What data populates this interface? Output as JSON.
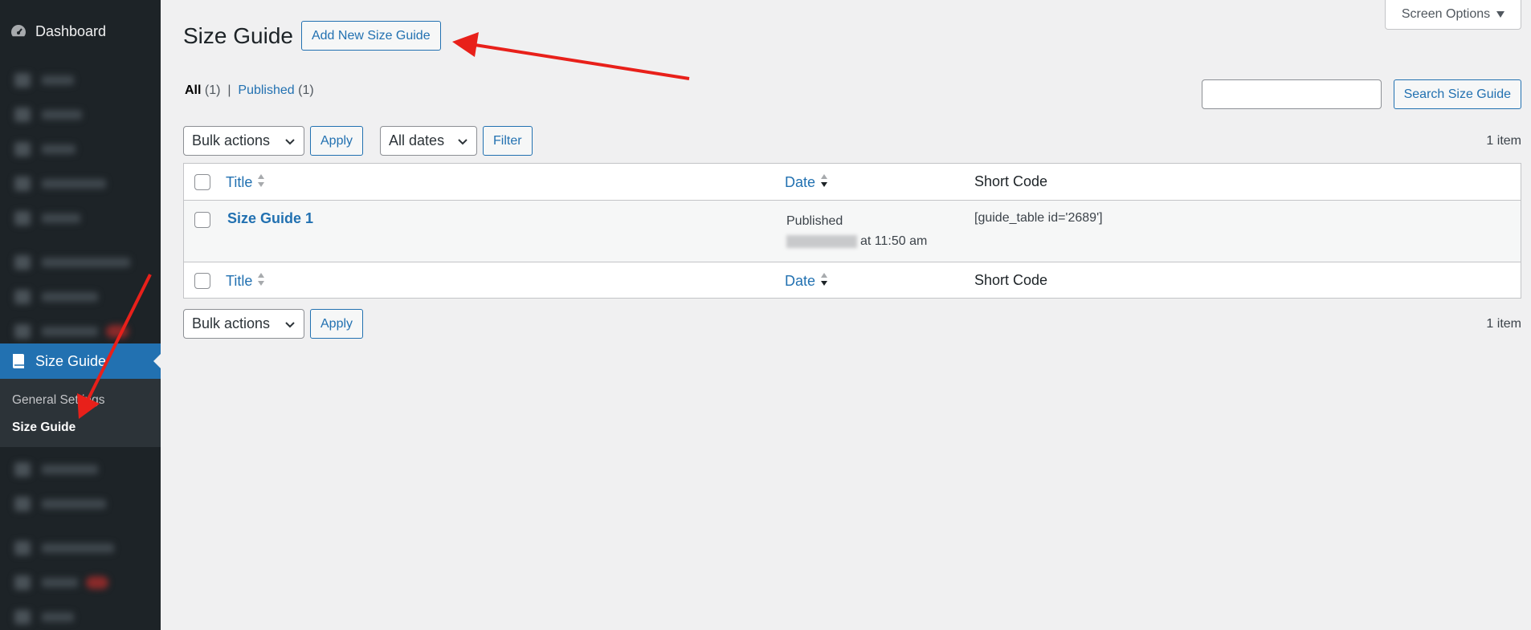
{
  "sidebar": {
    "dashboard_label": "Dashboard",
    "active_menu_label": "Size Guide",
    "submenu": [
      {
        "label": "General Settings"
      },
      {
        "label": "Size Guide"
      }
    ]
  },
  "screen_options": {
    "label": "Screen Options"
  },
  "header": {
    "title": "Size Guide",
    "add_new_label": "Add New Size Guide"
  },
  "views": {
    "all_label": "All",
    "all_count": "(1)",
    "separator": "|",
    "published_label": "Published",
    "published_count": "(1)"
  },
  "search": {
    "button_label": "Search Size Guide",
    "value": ""
  },
  "tablenav_top": {
    "bulk_actions": "Bulk actions",
    "apply_label": "Apply",
    "dates": "All dates",
    "filter_label": "Filter",
    "items_count": "1 item"
  },
  "table": {
    "columns": {
      "title": "Title",
      "date": "Date",
      "short_code": "Short Code"
    },
    "rows": [
      {
        "title": "Size Guide 1",
        "status": "Published",
        "time": "at 11:50 am",
        "short_code": "[guide_table id='2689']"
      }
    ]
  },
  "tablenav_bottom": {
    "bulk_actions": "Bulk actions",
    "apply_label": "Apply",
    "items_count": "1 item"
  },
  "colors": {
    "accent": "#2271b1",
    "sidebar": "#1d2327",
    "annotation_arrow": "#e8201a"
  }
}
